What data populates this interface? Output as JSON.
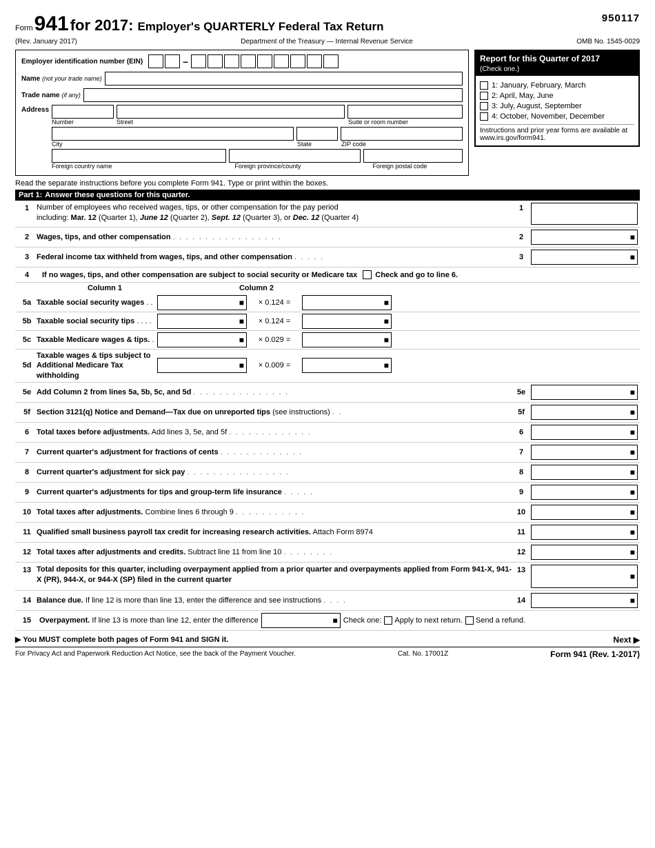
{
  "header": {
    "form_word": "Form",
    "form_number": "941",
    "for_year": "for 2017:",
    "description": "Employer's QUARTERLY Federal Tax Return",
    "rev": "(Rev. January 2017)",
    "dept": "Department of the Treasury — Internal Revenue Service",
    "page_num": "950117",
    "omb": "OMB No. 1545-0029"
  },
  "quarter_box": {
    "title": "Report for this Quarter of 2017",
    "check_one": "(Check one.)",
    "options": [
      "1: January, February, March",
      "2: April, May, June",
      "3: July, August, September",
      "4: October, November, December"
    ],
    "note": "Instructions and prior year forms are available at www.irs.gov/form941."
  },
  "fields": {
    "ein_label": "Employer identification number",
    "ein_abbr": "(EIN)",
    "name_label": "Name",
    "name_italic": "(not your trade name)",
    "trade_label": "Trade name",
    "trade_italic": "(if any)",
    "address_label": "Address",
    "num_label": "Number",
    "street_label": "Street",
    "suite_label": "Suite or room number",
    "city_label": "City",
    "state_label": "State",
    "zip_label": "ZIP code",
    "foreign_country_label": "Foreign country name",
    "foreign_province_label": "Foreign province/county",
    "foreign_postal_label": "Foreign postal code"
  },
  "instructions_line": "Read the separate instructions before you complete Form 941. Type or print within the boxes.",
  "part1": {
    "label": "Part 1:",
    "description": "Answer these questions for this quarter.",
    "lines": [
      {
        "num": "1",
        "desc": "Number of employees who received wages, tips, or other compensation for the pay period including: Mar. 12 (Quarter 1), June 12 (Quarter 2), Sept. 12 (Quarter 3), or Dec. 12 (Quarter 4)",
        "desc_bold_parts": [
          "Mar. 12",
          "June 12",
          "Sept. 12",
          "Dec. 12"
        ],
        "line_ref": "1"
      },
      {
        "num": "2",
        "desc": "Wages, tips, and other compensation",
        "line_ref": "2",
        "has_dots": true
      },
      {
        "num": "3",
        "desc": "Federal income tax withheld from wages, tips, and other compensation",
        "line_ref": "3",
        "has_dots": true
      }
    ]
  },
  "line4": {
    "num": "4",
    "desc": "If no wages, tips, and other compensation are subject to social security or Medicare tax",
    "check_label": "Check and go to line 6."
  },
  "columns": {
    "col1": "Column 1",
    "col2": "Column 2"
  },
  "lines_5": [
    {
      "num": "5a",
      "label": "Taxable social security wages",
      "dots": ". .",
      "multiplier": "× 0.124 ="
    },
    {
      "num": "5b",
      "label": "Taxable social security tips",
      "dots": ". . . .",
      "multiplier": "× 0.124 ="
    },
    {
      "num": "5c",
      "label": "Taxable Medicare wages & tips.",
      "dots": ".",
      "multiplier": "× 0.029 ="
    },
    {
      "num": "5d",
      "label": "Taxable wages & tips subject to Additional Medicare Tax withholding",
      "multiplier": "× 0.009 ="
    }
  ],
  "lines_rest": [
    {
      "num": "5e",
      "desc": "Add Column 2 from lines 5a, 5b, 5c, and 5d",
      "line_ref": "5e",
      "has_dots": true
    },
    {
      "num": "5f",
      "desc": "Section 3121(q) Notice and Demand—Tax due on unreported tips",
      "desc_note": "(see instructions)",
      "line_ref": "5f",
      "has_dots": true
    },
    {
      "num": "6",
      "desc": "Total taxes before adjustments.",
      "desc_normal": "Add lines 3, 5e, and 5f",
      "line_ref": "6",
      "has_dots": true
    },
    {
      "num": "7",
      "desc": "Current quarter's adjustment for fractions of cents",
      "line_ref": "7",
      "has_dots": true
    },
    {
      "num": "8",
      "desc": "Current quarter's adjustment for sick pay",
      "line_ref": "8",
      "has_dots": true
    },
    {
      "num": "9",
      "desc": "Current quarter's adjustments for tips and group-term life insurance",
      "line_ref": "9",
      "has_dots": true
    },
    {
      "num": "10",
      "desc": "Total taxes after adjustments.",
      "desc_normal": "Combine lines 6 through 9",
      "line_ref": "10",
      "has_dots": true
    },
    {
      "num": "11",
      "desc": "Qualified small business payroll tax credit for increasing research activities.",
      "desc_normal": "Attach Form 8974",
      "line_ref": "11"
    },
    {
      "num": "12",
      "desc": "Total taxes after adjustments and credits.",
      "desc_normal": "Subtract line 11 from line 10",
      "line_ref": "12",
      "has_dots": true
    },
    {
      "num": "13",
      "desc": "Total deposits for this quarter, including overpayment applied from a prior quarter and overpayments applied from Form 941-X, 941-X (PR), 944-X, or 944-X (SP) filed in the current quarter",
      "line_ref": "13"
    },
    {
      "num": "14",
      "desc": "Balance due.",
      "desc_normal": "If line 12 is more than line 13, enter the difference and see instructions",
      "line_ref": "14",
      "has_dots": true
    }
  ],
  "line15": {
    "num": "15",
    "desc": "Overpayment.",
    "desc_normal": "If line 13 is more than line 12, enter the difference",
    "check_one": "Check one:",
    "option1": "Apply to next return.",
    "option2": "Send a refund."
  },
  "footer": {
    "must_complete": "▶ You MUST complete both pages of Form 941 and SIGN it.",
    "next": "Next ▶",
    "privacy": "For Privacy Act and Paperwork Reduction Act Notice, see the back of the Payment Voucher.",
    "cat": "Cat. No. 17001Z",
    "form_id": "Form 941 (Rev. 1-2017)"
  }
}
